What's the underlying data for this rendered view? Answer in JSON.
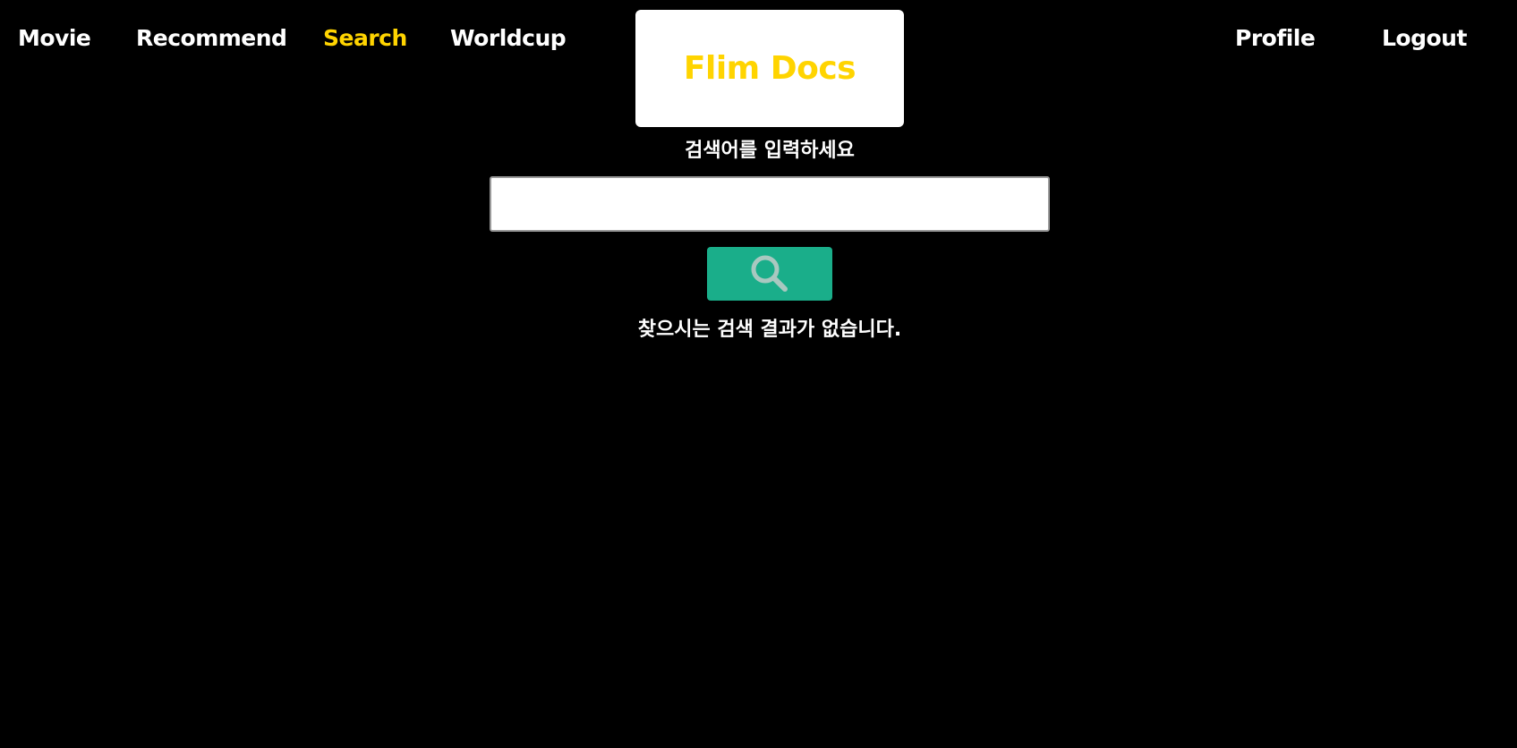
{
  "nav": {
    "movie": "Movie",
    "recommend": "Recommend",
    "search": "Search",
    "worldcup": "Worldcup",
    "profile": "Profile",
    "logout": "Logout",
    "active": "search"
  },
  "logo": {
    "text": "Flim Docs"
  },
  "search": {
    "label": "검색어를 입력하세요",
    "value": "",
    "placeholder": "",
    "button_icon": "search-icon"
  },
  "results": {
    "empty_message": "찾으시는 검색 결과가 없습니다."
  },
  "colors": {
    "background": "#000000",
    "accent": "#ffd400",
    "button": "#1aae8a",
    "icon": "#a9c8c0"
  }
}
